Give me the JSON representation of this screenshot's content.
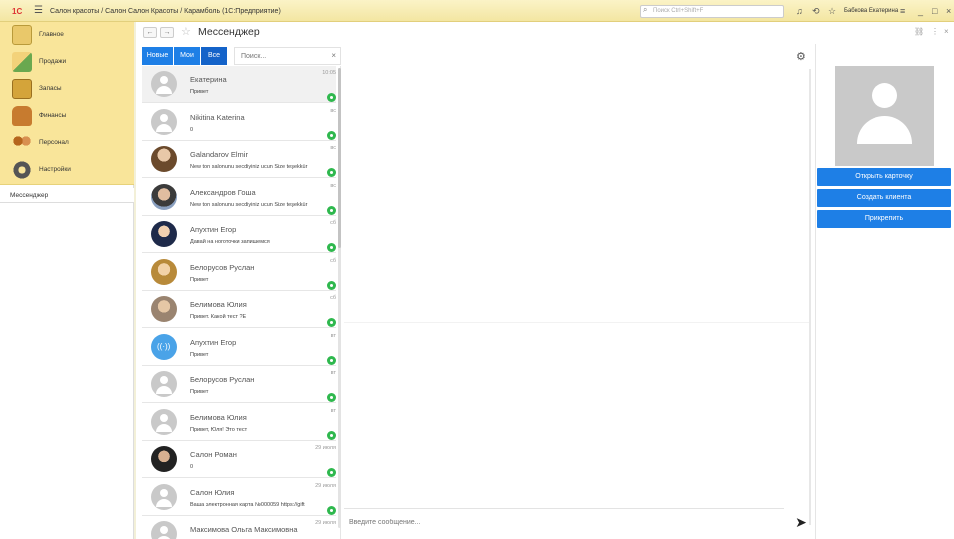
{
  "titlebar": {
    "logo": "1С",
    "menu_icon": "menu-icon",
    "title": "Салон красоты / Салон Салон Красоты / Карамболь  (1С:Предприятие)",
    "search_placeholder": "Поиск Ctrl+Shift+F",
    "user": "Бабкова Екатерина",
    "icons": [
      "bell-icon",
      "history-icon",
      "star-icon",
      "settings-icon",
      "minimize-icon",
      "maximize-icon",
      "close-icon"
    ]
  },
  "sidebar": {
    "sections": [
      {
        "label": "Главное",
        "icon": "home-icon",
        "color": "#e9c86a"
      },
      {
        "label": "Продажи",
        "icon": "sales-chart-icon",
        "color": "#6aa84f"
      },
      {
        "label": "Запасы",
        "icon": "stock-icon",
        "color": "#d4a43a"
      },
      {
        "label": "Финансы",
        "icon": "finance-icon",
        "color": "#c77b2f"
      },
      {
        "label": "Персонал",
        "icon": "staff-icon",
        "color": "#b5651d"
      },
      {
        "label": "Настройки",
        "icon": "settings-gear-icon",
        "color": "#555555"
      }
    ],
    "open_item": "Мессенджер"
  },
  "header": {
    "back": "←",
    "forward": "→",
    "title": "Мессенджер",
    "link_icon": "link-icon",
    "more_icon": "more-icon",
    "close_icon": "close-icon"
  },
  "tabs": [
    {
      "label": "Новые"
    },
    {
      "label": "Мои"
    },
    {
      "label": "Все"
    }
  ],
  "search": {
    "placeholder": "Поиск...",
    "clear": "×"
  },
  "chats": [
    {
      "name": "Екатерина",
      "message": "Привет",
      "time": "10:05",
      "avatar": "default"
    },
    {
      "name": "Nikitina Katerina",
      "message": "0",
      "time": "вс",
      "avatar": "default"
    },
    {
      "name": "Galandarov Elmir",
      "message": "New ton salonunu secdiyiniz ucun Size teşekkür",
      "time": "вс",
      "avatar": "photo1"
    },
    {
      "name": "Александров Гоша",
      "message": "New ton salonunu secdiyiniz ucun Size teşekkür",
      "time": "вс",
      "avatar": "photo2"
    },
    {
      "name": "Апухтин Егор",
      "message": "Давай на ноготочки запишемся",
      "time": "сб",
      "avatar": "photo3"
    },
    {
      "name": "Белорусов Руслан",
      "message": "Привет",
      "time": "сб",
      "avatar": "photo4"
    },
    {
      "name": "Белимова Юлия",
      "message": "Привет. Какой тест ?Ё",
      "time": "сб",
      "avatar": "photo5"
    },
    {
      "name": "Апухтин Егор",
      "message": "Привет",
      "time": "вт",
      "avatar": "blue"
    },
    {
      "name": "Белорусов Руслан",
      "message": "Привет",
      "time": "вт",
      "avatar": "default"
    },
    {
      "name": "Белимова Юлия",
      "message": "Привет, Юля! Это тест",
      "time": "вт",
      "avatar": "default"
    },
    {
      "name": "Салон Роман",
      "message": "0",
      "time": "29 июля",
      "avatar": "photo6"
    },
    {
      "name": "Салон Юлия",
      "message": "Ваша электронная карта №000059 https://gift",
      "time": "29 июля",
      "avatar": "default"
    },
    {
      "name": "Максимова Ольга Максимовна",
      "message": "",
      "time": "29 июля",
      "avatar": "default"
    }
  ],
  "message_input": {
    "placeholder": "Введите сообщение..."
  },
  "right_panel": {
    "buttons": [
      {
        "label": "Открыть карточку"
      },
      {
        "label": "Создать клиента"
      },
      {
        "label": "Прикрепить"
      }
    ]
  },
  "colors": {
    "accent": "#1e7fe6",
    "sidebar_bg": "#f9e59a",
    "whatsapp": "#2fb84e"
  }
}
